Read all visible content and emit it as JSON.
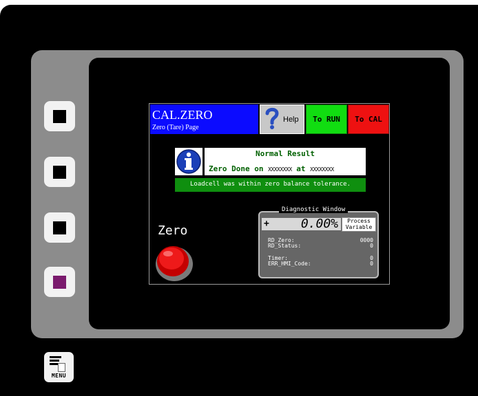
{
  "menu_key": {
    "label": "MENU"
  },
  "header": {
    "title": "CAL.ZERO",
    "subtitle": "Zero (Tare) Page",
    "help_label": "Help",
    "to_run_label": "To RUN",
    "to_cal_label": "To CAL"
  },
  "result": {
    "title": "Normal Result",
    "detail_prefix": "Zero Done on",
    "detail_date": "XXXXXXXX",
    "detail_mid": "at",
    "detail_time": "XXXXXXXX",
    "tolerance_message": "Loadcell was within zero balance tolerance."
  },
  "zero": {
    "label": "Zero"
  },
  "diagnostic": {
    "title": "Diagnostic Window",
    "sign": "+",
    "value": "0.00%",
    "pv_label_line1": "Process",
    "pv_label_line2": "Variable",
    "rows": [
      {
        "label": "RD_Zero:",
        "value": "0000"
      },
      {
        "label": "RD_Status:",
        "value": "0"
      },
      {
        "label": "Timer:",
        "value": "0"
      },
      {
        "label": "ERR_HMI_Code:",
        "value": "0"
      }
    ]
  },
  "colors": {
    "title_bar": "#0b0bff",
    "run_button": "#11dd11",
    "cal_button": "#ee1111",
    "result_text": "#006000",
    "tolerance_bar": "#0f8f0f",
    "softkey_4_indicator": "#7b1b6e"
  }
}
